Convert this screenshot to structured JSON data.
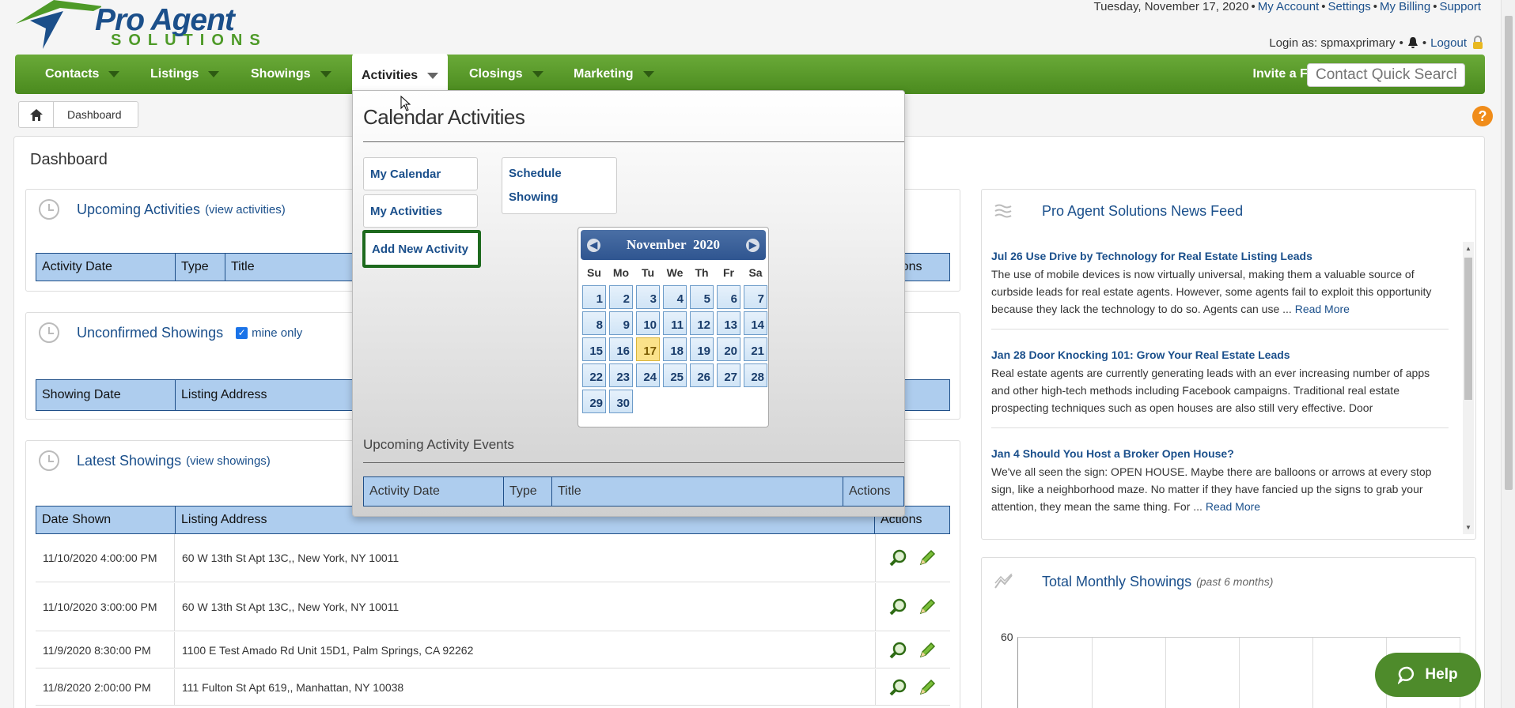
{
  "header": {
    "logo_line1": "Pro Agent",
    "logo_line2": "SOLUTIONS",
    "date": "Tuesday, November 17, 2020",
    "links": [
      "My Account",
      "Settings",
      "My Billing",
      "Support"
    ],
    "login_label": "Login as: spmaxprimary",
    "logout": "Logout"
  },
  "nav": {
    "items": [
      "Contacts",
      "Listings",
      "Showings",
      "Activities",
      "Closings",
      "Marketing"
    ],
    "invite": "Invite a Friend",
    "search_placeholder": "Contact Quick Search"
  },
  "breadcrumb": {
    "current": "Dashboard"
  },
  "dashboard": {
    "title": "Dashboard",
    "upcoming": {
      "title": "Upcoming Activities",
      "link": "(view activities)",
      "columns": [
        "Activity Date",
        "Type",
        "Title",
        "Actions"
      ]
    },
    "unconfirmed": {
      "title": "Unconfirmed Showings",
      "checkbox_label": "mine only",
      "columns": [
        "Showing Date",
        "Listing Address"
      ]
    },
    "latest": {
      "title": "Latest Showings",
      "link": "(view showings)",
      "columns": [
        "Date Shown",
        "Listing Address",
        "Actions"
      ],
      "rows": [
        {
          "date": "11/10/2020 4:00:00 PM",
          "address": "60 W 13th St Apt 13C,, New York, NY 10011"
        },
        {
          "date": "11/10/2020 3:00:00 PM",
          "address": "60 W 13th St Apt 13C,, New York, NY 10011"
        },
        {
          "date": "11/9/2020 8:30:00 PM",
          "address": "1100 E Test Amado Rd Unit 15D1, Palm Springs, CA 92262"
        },
        {
          "date": "11/8/2020 2:00:00 PM",
          "address": "111 Fulton St Apt 619,, Manhattan, NY 10038"
        }
      ]
    },
    "news": {
      "title": "Pro Agent Solutions News Feed",
      "items": [
        {
          "title": "Jul 26 Use Drive by Technology for Real Estate Listing Leads",
          "text": "The use of mobile devices is now virtually universal, making them a valuable source of curbside leads for real estate agents. However, some agents fail to exploit this opportunity because they lack the technology to do so. Agents can use ...",
          "more": "Read More"
        },
        {
          "title": "Jan 28 Door Knocking 101: Grow Your Real Estate Leads",
          "text": "Real estate agents are currently generating leads with an ever increasing number of apps and other high-tech methods including Facebook campaigns. Traditional real estate prospecting techniques such as open houses are also still very effective. Door",
          "more": ""
        },
        {
          "title": "Jan 4 Should You Host a Broker Open House?",
          "text": "We've all seen the sign: OPEN HOUSE. Maybe there are balloons or arrows at every stop sign, like a neighborhood maze. No matter if they have fancied up the signs to grab your attention, they mean the same thing. For ...",
          "more": "Read More"
        }
      ]
    },
    "chart": {
      "title": "Total Monthly Showings",
      "subtitle": "(past 6 months)",
      "y_top": "60"
    }
  },
  "dropdown": {
    "title": "Calendar Activities",
    "buttons": [
      "My Calendar",
      "My Activities",
      "Add New Activity"
    ],
    "schedule_line1": "Schedule",
    "schedule_line2": "Showing",
    "calendar": {
      "month": "November",
      "year": "2020",
      "dow": [
        "Su",
        "Mo",
        "Tu",
        "We",
        "Th",
        "Fr",
        "Sa"
      ],
      "days": [
        "1",
        "2",
        "3",
        "4",
        "5",
        "6",
        "7",
        "8",
        "9",
        "10",
        "11",
        "12",
        "13",
        "14",
        "15",
        "16",
        "17",
        "18",
        "19",
        "20",
        "21",
        "22",
        "23",
        "24",
        "25",
        "26",
        "27",
        "28",
        "29",
        "30"
      ],
      "today": "17"
    },
    "upcoming_title": "Upcoming Activity Events",
    "columns": [
      "Activity Date",
      "Type",
      "Title",
      "Actions"
    ]
  },
  "help": {
    "label": "Help"
  }
}
